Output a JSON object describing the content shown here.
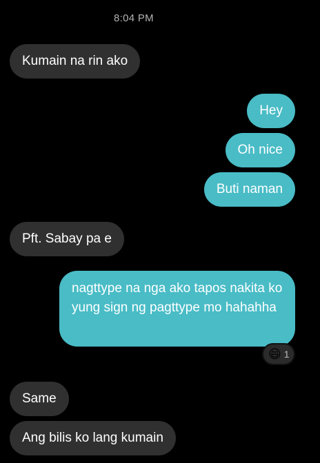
{
  "conversation": {
    "timestamp": "8:04 PM",
    "messages": [
      {
        "side": "received",
        "text": "Kumain na rin ako"
      },
      {
        "side": "sent",
        "text": "Hey"
      },
      {
        "side": "sent",
        "text": "Oh nice"
      },
      {
        "side": "sent",
        "text": "Buti naman"
      },
      {
        "side": "received",
        "text": "Pft. Sabay pa e"
      },
      {
        "side": "sent",
        "text": "nagttype na nga ako tapos nakita ko yung sign ng pagttype mo hahahha"
      },
      {
        "side": "received",
        "text": "Same"
      },
      {
        "side": "received",
        "text": "Ang bilis ko lang kumain"
      }
    ],
    "reaction": {
      "emoji": "😄",
      "count": "1"
    }
  },
  "colors": {
    "background": "#000000",
    "received_bubble": "#303030",
    "sent_bubble": "#49bcc6",
    "text": "#ffffff",
    "timestamp": "#b3b3b3"
  }
}
